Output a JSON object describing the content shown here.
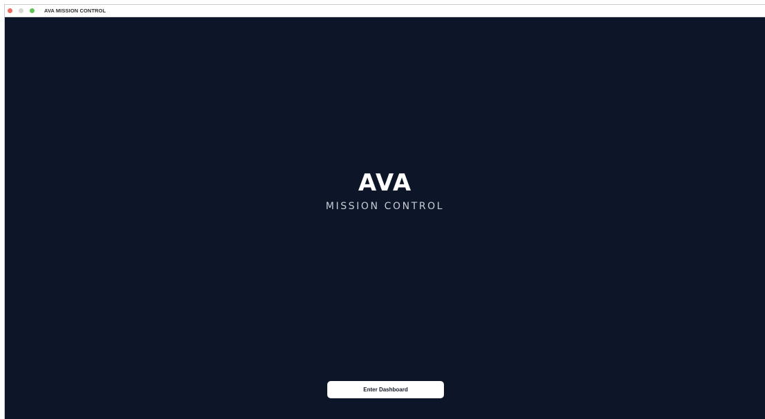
{
  "window": {
    "title": "AVA MISSION CONTROL",
    "controls": [
      "close",
      "minimize",
      "maximize"
    ]
  },
  "splash": {
    "logo_text": "AVA",
    "subtitle": "MISSION CONTROL",
    "enter_button_label": "Enter Dashboard"
  },
  "colors": {
    "background": "#0d1628",
    "logo": "#ffffff",
    "subtitle": "#c8ccd3",
    "button_bg": "#ffffff",
    "button_text": "#111827",
    "close_dot": "#ec6a5e",
    "minimize_dot": "#d7d7d7",
    "maximize_dot": "#5fc453"
  }
}
